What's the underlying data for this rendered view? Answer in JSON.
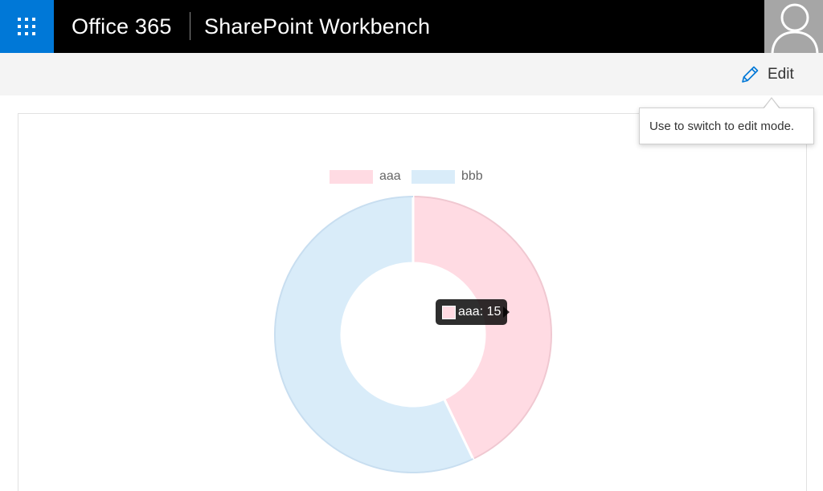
{
  "suitebar": {
    "brand": "Office 365",
    "app_title": "SharePoint Workbench",
    "accent_color": "#0078d7"
  },
  "commandbar": {
    "edit_label": "Edit",
    "edit_icon": "pencil-icon",
    "tooltip": "Use to switch to edit mode."
  },
  "chart_data": {
    "type": "pie",
    "variant": "doughnut",
    "categories": [
      "aaa",
      "bbb"
    ],
    "values": [
      15,
      20
    ],
    "colors": [
      "#ffdbe3",
      "#d9ecf9"
    ],
    "border_colors": [
      "#f0c8d1",
      "#c8def0"
    ],
    "legend_position": "top",
    "hover_tooltip": {
      "label": "aaa",
      "value": "15",
      "text": "aaa: 15"
    }
  }
}
